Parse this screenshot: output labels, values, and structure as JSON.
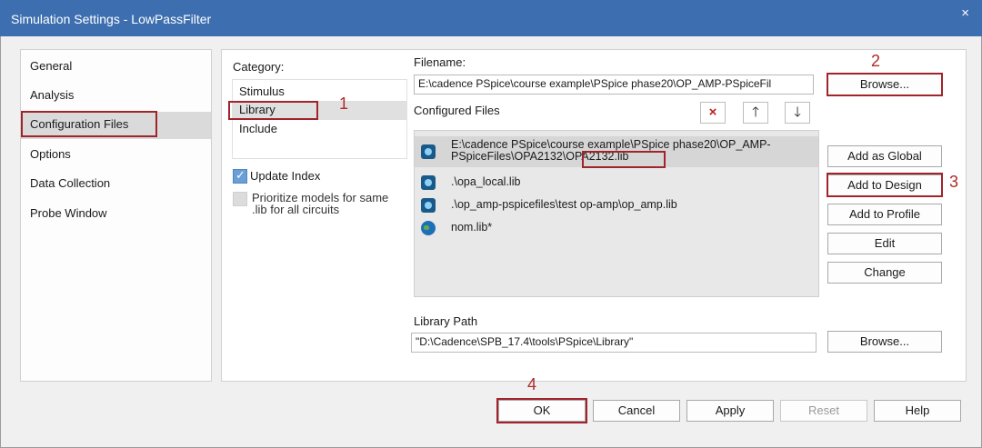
{
  "window": {
    "title": "Simulation Settings - LowPassFilter",
    "close_glyph": "×"
  },
  "nav": {
    "items": [
      {
        "label": "General"
      },
      {
        "label": "Analysis"
      },
      {
        "label": "Configuration Files",
        "selected": true
      },
      {
        "label": "Options"
      },
      {
        "label": "Data Collection"
      },
      {
        "label": "Probe Window"
      }
    ]
  },
  "category": {
    "label": "Category:",
    "items": [
      {
        "label": "Stimulus"
      },
      {
        "label": "Library",
        "selected": true
      },
      {
        "label": "Include"
      }
    ]
  },
  "options": {
    "update_index": {
      "label": "Update Index",
      "checked": true
    },
    "prioritize": {
      "line1": "Prioritize models for same",
      "line2": ".lib for all circuits",
      "checked": false,
      "enabled": false
    }
  },
  "filename": {
    "label": "Filename:",
    "value": "E:\\cadence PSpice\\course example\\PSpice phase20\\OP_AMP-PSpiceFil",
    "browse_label": "Browse..."
  },
  "configured_files": {
    "label": "Configured Files",
    "delete_icon": "×",
    "up_icon": "🡑",
    "down_icon": "🡓",
    "items": [
      {
        "line1": "E:\\cadence PSpice\\course example\\PSpice phase20\\OP_AMP-",
        "line2": "PSpiceFiles\\OPA2132\\OPA2132.lib",
        "icon": "library-icon",
        "selected": true
      },
      {
        "line1": ".\\opa_local.lib",
        "icon": "library-icon"
      },
      {
        "line1": ".\\op_amp-pspicefiles\\test op-amp\\op_amp.lib",
        "icon": "library-icon"
      },
      {
        "line1": "nom.lib*",
        "icon": "globe-icon"
      }
    ]
  },
  "side_buttons": {
    "add_global": "Add as Global",
    "add_design": "Add to Design",
    "add_profile": "Add to Profile",
    "edit": "Edit",
    "change": "Change"
  },
  "library_path": {
    "label": "Library Path",
    "value": "\"D:\\Cadence\\SPB_17.4\\tools\\PSpice\\Library\"",
    "browse_label": "Browse..."
  },
  "footer": {
    "ok": "OK",
    "cancel": "Cancel",
    "apply": "Apply",
    "reset": "Reset",
    "help": "Help"
  },
  "annotations": {
    "step1": "1",
    "step2": "2",
    "step3": "3",
    "step4": "4",
    "color": "#a0242a"
  }
}
